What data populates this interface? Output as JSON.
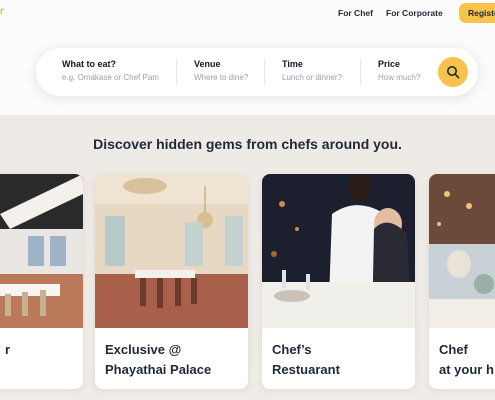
{
  "nav": {
    "logo_fragment": "r",
    "links": [
      "For Chef",
      "For Corporate"
    ],
    "register_label": "Register"
  },
  "search": {
    "fields": [
      {
        "label": "What to eat?",
        "placeholder": "e.g. Omakase or Chef Pam"
      },
      {
        "label": "Venue",
        "placeholder": "Where to dine?"
      },
      {
        "label": "Time",
        "placeholder": "Lunch or dinner?"
      },
      {
        "label": "Price",
        "placeholder": "How much?"
      }
    ],
    "button_icon": "search-icon"
  },
  "heading": "Discover hidden gems from chefs around you.",
  "cards": [
    {
      "title": "r"
    },
    {
      "title": "Exclusive @\nPhayathai Palace"
    },
    {
      "title": "Chef’s\nRestuarant"
    },
    {
      "title": "Chef\nat your h"
    }
  ],
  "colors": {
    "accent": "#f6c34b",
    "text": "#1f2937"
  }
}
